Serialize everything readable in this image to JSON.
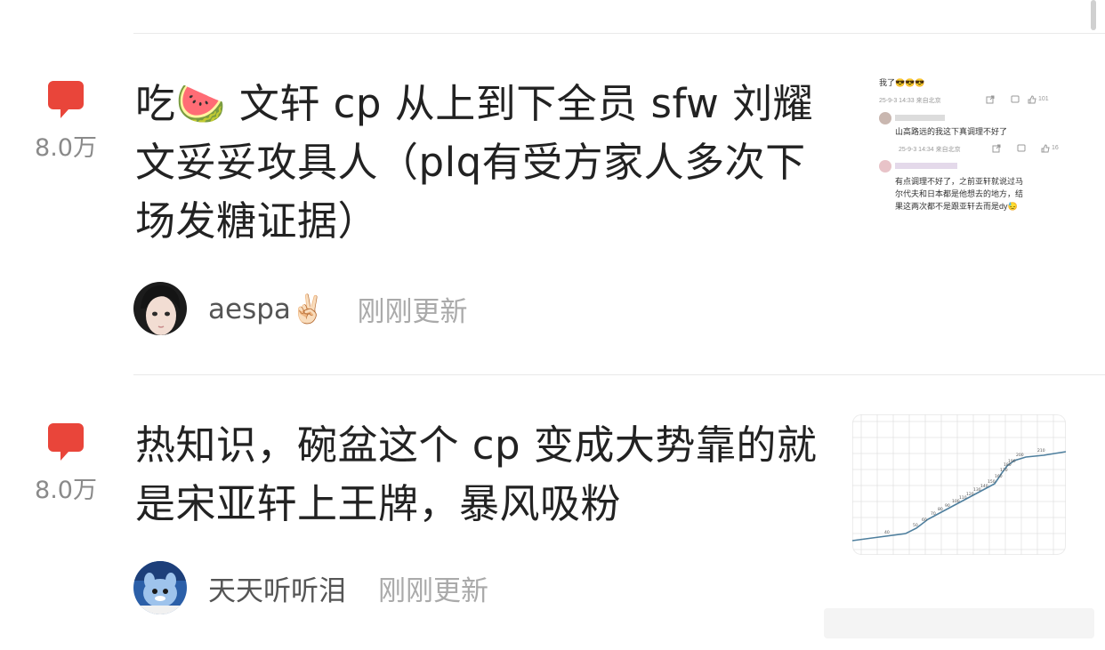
{
  "posts": [
    {
      "heat": "8.0万",
      "title": "吃🍉 文轩 cp 从上到下全员 sfw 刘耀文妥妥攻具人（plq有受方家人多次下场发糖证据）",
      "author": "aespa✌🏻",
      "time": "刚刚更新",
      "thumbnail": {
        "header": "我了😎😎😎",
        "meta1": "25-9-3 14:33 来自北京",
        "likes1": "101",
        "reply1": "山高路远的我这下真调理不好了",
        "meta2": "25-9-3 14:34 来自北京",
        "likes2": "16",
        "reply2_line1": "有点调理不好了，之前亚轩就说过马",
        "reply2_line2": "尔代夫和日本都是他想去的地方，结",
        "reply2_line3": "果这两次都不是跟亚轩去而是dy😓"
      }
    },
    {
      "heat": "8.0万",
      "title": "热知识，碗盆这个 cp 变成大势靠的就是宋亚轩上王牌，暴风吸粉",
      "author": "天天听听泪",
      "time": "刚刚更新",
      "thumbnail": {
        "labels": [
          "40",
          "50",
          "60",
          "70",
          "80",
          "90",
          "100",
          "110",
          "120",
          "130",
          "140",
          "150",
          "160",
          "170",
          "180",
          "190",
          "200",
          "210"
        ]
      }
    }
  ],
  "colors": {
    "heat_red": "#e9453a",
    "divider": "#e9e9e9",
    "text_primary": "#222222",
    "text_muted": "#aaaaaa"
  },
  "icons": [
    "heat-bubble-icon",
    "share-icon",
    "comment-icon",
    "like-icon"
  ]
}
